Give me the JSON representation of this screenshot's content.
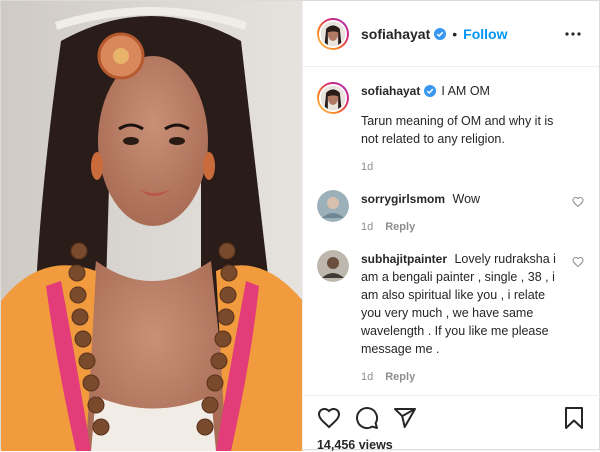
{
  "header": {
    "username": "sofiahayat",
    "follow_label": "Follow",
    "separator": "•"
  },
  "caption": {
    "username": "sofiahayat",
    "title": "I AM OM",
    "text": "Tarun meaning of OM and why it is not related to any religion.",
    "time": "1d"
  },
  "comments": [
    {
      "username": "sorrygirlsmom",
      "text": "Wow",
      "time": "1d",
      "reply_label": "Reply"
    },
    {
      "username": "subhajitpainter",
      "text": "Lovely rudraksha i am a bengali painter , single , 38 , i am also spiritual like you , i relate you very much , we have same wavelength . If you like me please message me .",
      "time": "1d",
      "reply_label": "Reply"
    }
  ],
  "actions": {
    "views_count": "14,456",
    "views_label": "views"
  },
  "icons": [
    "verified-badge-icon",
    "more-options-icon",
    "heart-icon",
    "comment-icon",
    "share-icon",
    "bookmark-icon"
  ],
  "colors": {
    "link_blue": "#0095f6",
    "text": "#262626",
    "muted": "#8e8e8e",
    "border": "#dbdbdb"
  }
}
